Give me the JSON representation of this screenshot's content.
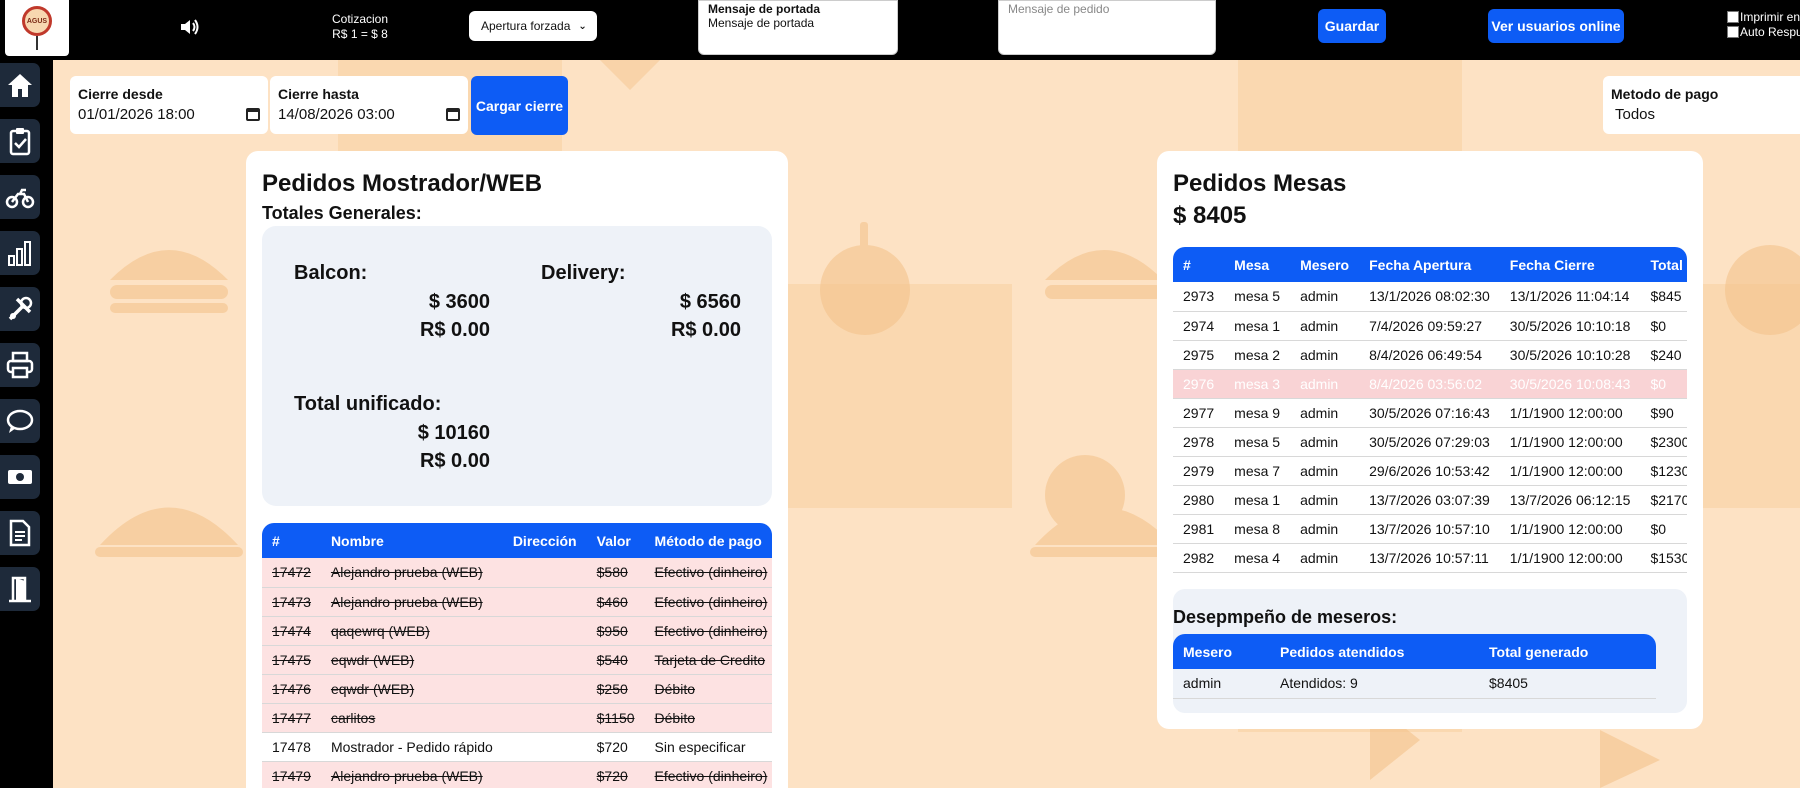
{
  "header": {
    "logo_text": "AGUS",
    "cotizacion_title": "Cotizacion",
    "cotizacion_value": "R$ 1 = $ 8",
    "apertura_select": "Apertura forzada",
    "mensaje_portada_label": "Mensaje de portada",
    "mensaje_portada_value": "Mensaje de portada",
    "mensaje_pedido_placeholder": "Mensaje de pedido",
    "guardar_label": "Guardar",
    "usuarios_online_label": "Ver usuarios online",
    "imprimir_label": "Imprimir en",
    "auto_respuesta_label": "Auto Respu"
  },
  "sidebar": {
    "icons": [
      "home-icon",
      "clipboard-check-icon",
      "motorcycle-icon",
      "bar-chart-icon",
      "tools-icon",
      "printer-icon",
      "chat-icon",
      "money-icon",
      "document-icon",
      "exit-door-icon"
    ]
  },
  "filters": {
    "desde_label": "Cierre desde",
    "desde_value": "01/01/2026 18:00",
    "hasta_label": "Cierre hasta",
    "hasta_value": "14/08/2026 03:00",
    "cargar_label": "Cargar cierre",
    "metodo_label": "Metodo de pago",
    "metodo_value": "Todos"
  },
  "mostrador": {
    "title": "Pedidos Mostrador/WEB",
    "subtitle": "Totales Generales:",
    "balcon_label": "Balcon:",
    "balcon_ars": "$ 3600",
    "balcon_brl": "R$ 0.00",
    "delivery_label": "Delivery:",
    "delivery_ars": "$ 6560",
    "delivery_brl": "R$ 0.00",
    "total_label": "Total unificado:",
    "total_ars": "$ 10160",
    "total_brl": "R$ 0.00",
    "columns": [
      "#",
      "Nombre",
      "Dirección",
      "Valor",
      "Método de pago"
    ],
    "rows": [
      {
        "id": "17472",
        "nombre": "Alejandro prueba (WEB)",
        "direccion": "",
        "valor": "$580",
        "metodo": "Efectivo (dinheiro)",
        "cancelled": true
      },
      {
        "id": "17473",
        "nombre": "Alejandro prueba (WEB)",
        "direccion": "",
        "valor": "$460",
        "metodo": "Efectivo (dinheiro)",
        "cancelled": true
      },
      {
        "id": "17474",
        "nombre": "qaqewrq (WEB)",
        "direccion": "",
        "valor": "$950",
        "metodo": "Efectivo (dinheiro)",
        "cancelled": true
      },
      {
        "id": "17475",
        "nombre": "eqwdr (WEB)",
        "direccion": "",
        "valor": "$540",
        "metodo": "Tarjeta de Credito",
        "cancelled": true
      },
      {
        "id": "17476",
        "nombre": "eqwdr (WEB)",
        "direccion": "",
        "valor": "$250",
        "metodo": "Débito",
        "cancelled": true
      },
      {
        "id": "17477",
        "nombre": "carlitos",
        "direccion": "",
        "valor": "$1150",
        "metodo": "Débito",
        "cancelled": true
      },
      {
        "id": "17478",
        "nombre": "Mostrador - Pedido rápido",
        "direccion": "",
        "valor": "$720",
        "metodo": "Sin especificar",
        "cancelled": false
      },
      {
        "id": "17479",
        "nombre": "Alejandro prueba (WEB)",
        "direccion": "",
        "valor": "$720",
        "metodo": "Efectivo (dinheiro)",
        "cancelled": true
      }
    ]
  },
  "mesas": {
    "title": "Pedidos Mesas",
    "total": "$ 8405",
    "columns": [
      "#",
      "Mesa",
      "Mesero",
      "Fecha Apertura",
      "Fecha Cierre",
      "Total"
    ],
    "rows": [
      {
        "id": "2973",
        "mesa": "mesa 5",
        "mesero": "admin",
        "apertura": "13/1/2026 08:02:30",
        "cierre": "13/1/2026 11:04:14",
        "total": "$845",
        "deleted": false
      },
      {
        "id": "2974",
        "mesa": "mesa 1",
        "mesero": "admin",
        "apertura": "7/4/2026 09:59:27",
        "cierre": "30/5/2026 10:10:18",
        "total": "$0",
        "deleted": false
      },
      {
        "id": "2975",
        "mesa": "mesa 2",
        "mesero": "admin",
        "apertura": "8/4/2026 06:49:54",
        "cierre": "30/5/2026 10:10:28",
        "total": "$240",
        "deleted": false
      },
      {
        "id": "2976",
        "mesa": "mesa 3",
        "mesero": "admin",
        "apertura": "8/4/2026 03:56:02",
        "cierre": "30/5/2026 10:08:43",
        "total": "$0",
        "deleted": true
      },
      {
        "id": "2977",
        "mesa": "mesa 9",
        "mesero": "admin",
        "apertura": "30/5/2026 07:16:43",
        "cierre": "1/1/1900 12:00:00",
        "total": "$90",
        "deleted": false
      },
      {
        "id": "2978",
        "mesa": "mesa 5",
        "mesero": "admin",
        "apertura": "30/5/2026 07:29:03",
        "cierre": "1/1/1900 12:00:00",
        "total": "$2300",
        "deleted": false
      },
      {
        "id": "2979",
        "mesa": "mesa 7",
        "mesero": "admin",
        "apertura": "29/6/2026 10:53:42",
        "cierre": "1/1/1900 12:00:00",
        "total": "$1230",
        "deleted": false
      },
      {
        "id": "2980",
        "mesa": "mesa 1",
        "mesero": "admin",
        "apertura": "13/7/2026 03:07:39",
        "cierre": "13/7/2026 06:12:15",
        "total": "$2170",
        "deleted": false
      },
      {
        "id": "2981",
        "mesa": "mesa 8",
        "mesero": "admin",
        "apertura": "13/7/2026 10:57:10",
        "cierre": "1/1/1900 12:00:00",
        "total": "$0",
        "deleted": false
      },
      {
        "id": "2982",
        "mesa": "mesa 4",
        "mesero": "admin",
        "apertura": "13/7/2026 10:57:11",
        "cierre": "1/1/1900 12:00:00",
        "total": "$1530",
        "deleted": false
      }
    ],
    "desempeno_title": "Desepmpeño de meseros:",
    "desempeno_columns": [
      "Mesero",
      "Pedidos atendidos",
      "Total generado"
    ],
    "desempeno_rows": [
      {
        "mesero": "admin",
        "atendidos": "Atendidos: 9",
        "total": "$8405"
      }
    ]
  },
  "colors": {
    "accent": "#0d5cf5",
    "background": "#fde2c4",
    "cancelled_row": "#fde2e2"
  }
}
